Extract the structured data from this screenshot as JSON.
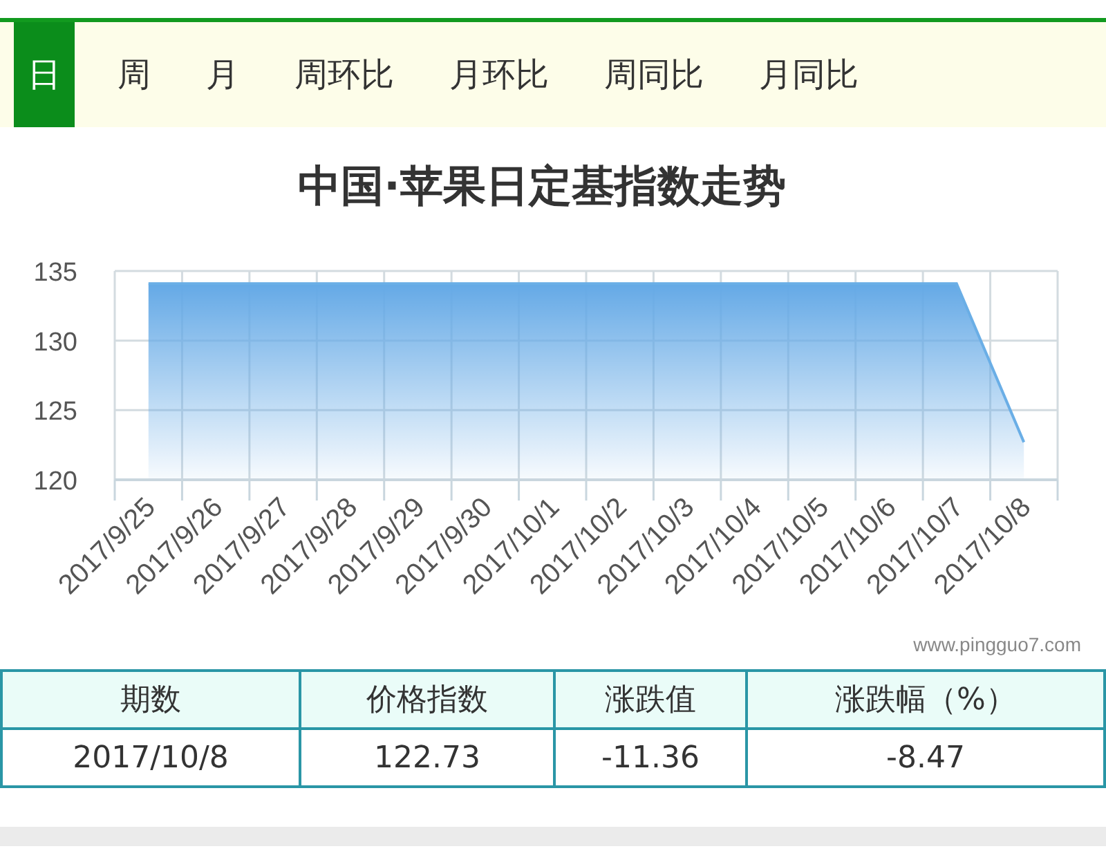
{
  "tabs": [
    {
      "label": "日",
      "selected": true
    },
    {
      "label": "周",
      "selected": false
    },
    {
      "label": "月",
      "selected": false
    },
    {
      "label": "周环比",
      "selected": false
    },
    {
      "label": "月环比",
      "selected": false
    },
    {
      "label": "周同比",
      "selected": false
    },
    {
      "label": "月同比",
      "selected": false
    }
  ],
  "chart": {
    "chart_data": {
      "type": "area",
      "title": "中国·苹果日定基指数走势",
      "categories": [
        "2017/9/25",
        "2017/9/26",
        "2017/9/27",
        "2017/9/28",
        "2017/9/29",
        "2017/9/30",
        "2017/10/1",
        "2017/10/2",
        "2017/10/3",
        "2017/10/4",
        "2017/10/5",
        "2017/10/6",
        "2017/10/7",
        "2017/10/8"
      ],
      "values": [
        134.1,
        134.1,
        134.1,
        134.1,
        134.1,
        134.1,
        134.1,
        134.1,
        134.1,
        134.1,
        134.1,
        134.1,
        134.1,
        122.7
      ],
      "grid": true,
      "ylim": [
        120,
        135
      ],
      "yticks": [
        120,
        125,
        130,
        135
      ]
    },
    "credit": "www.pingguo7.com"
  },
  "table": {
    "columns": [
      "期数",
      "价格指数",
      "涨跌值",
      "涨跌幅（%）"
    ],
    "rows": [
      [
        "2017/10/8",
        "122.73",
        "-11.36",
        "-8.47"
      ]
    ]
  }
}
